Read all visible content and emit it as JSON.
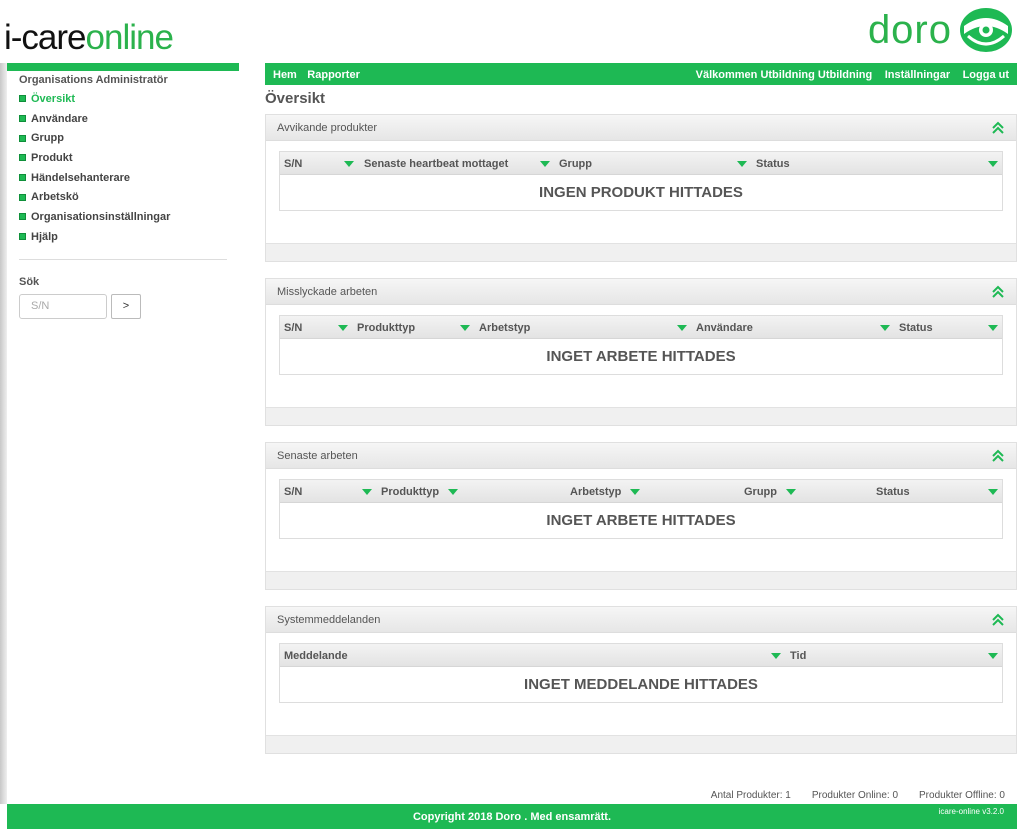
{
  "brand": {
    "logo_prefix": "i-care",
    "logo_suffix": "online",
    "partner_logo": "doro",
    "partner_icon": "doro-logo-icon",
    "accent": "#1eb954"
  },
  "sidebar": {
    "title": "Organisations Administratör",
    "items": [
      {
        "label": "Översikt",
        "active": true
      },
      {
        "label": "Användare"
      },
      {
        "label": "Grupp"
      },
      {
        "label": "Produkt"
      },
      {
        "label": "Händelsehanterare"
      },
      {
        "label": "Arbetskö"
      },
      {
        "label": "Organisationsinställningar"
      },
      {
        "label": "Hjälp"
      }
    ],
    "search": {
      "label": "Sök",
      "placeholder": "S/N",
      "button_label": ">"
    }
  },
  "topnav": {
    "left": [
      "Hem",
      "Rapporter"
    ],
    "welcome": "Välkommen Utbildning Utbildning",
    "settings": "Inställningar",
    "logout": "Logga ut"
  },
  "page_title": "Översikt",
  "panels": [
    {
      "title": "Avvikande produkter",
      "columns": [
        "S/N",
        "Senaste heartbeat mottaget",
        "Grupp",
        "Status"
      ],
      "empty": "INGEN PRODUKT HITTADES"
    },
    {
      "title": "Misslyckade arbeten",
      "columns": [
        "S/N",
        "Produkttyp",
        "Arbetstyp",
        "Användare",
        "Status"
      ],
      "empty": "INGET ARBETE HITTADES"
    },
    {
      "title": "Senaste arbeten",
      "columns": [
        "S/N",
        "Produkttyp",
        "Arbetstyp",
        "Grupp",
        "Status"
      ],
      "empty": "INGET ARBETE HITTADES"
    },
    {
      "title": "Systemmeddelanden",
      "columns": [
        "Meddelande",
        "Tid"
      ],
      "empty": "INGET MEDDELANDE HITTADES"
    }
  ],
  "stats": {
    "products": "Antal Produkter: 1",
    "online": "Produkter Online: 0",
    "offline": "Produkter Offline: 0"
  },
  "footer": {
    "copyright": "Copyright 2018 Doro . Med ensamrätt.",
    "version": "icare-online v3.2.0"
  }
}
